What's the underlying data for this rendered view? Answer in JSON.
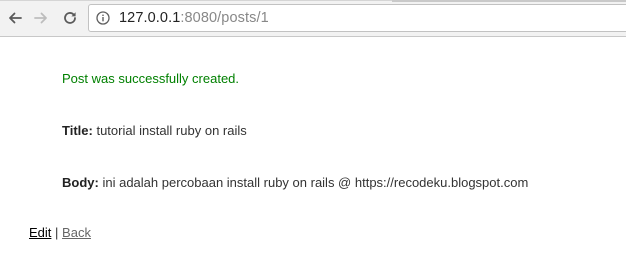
{
  "browser": {
    "url_host": "127.0.0.1",
    "url_rest": ":8080/posts/1",
    "icons": {
      "back": "arrow-left-icon",
      "forward": "arrow-right-icon",
      "reload": "reload-icon",
      "info": "info-icon"
    }
  },
  "page": {
    "notice": "Post was successfully created.",
    "title_label": "Title:",
    "title_value": "tutorial install ruby on rails",
    "body_label": "Body:",
    "body_value": "ini adalah percobaan install ruby on rails @ https://recodeku.blogspot.com",
    "edit_link": "Edit",
    "separator": "|",
    "back_link": "Back"
  },
  "colors": {
    "notice": "#008000",
    "text": "#333333"
  }
}
